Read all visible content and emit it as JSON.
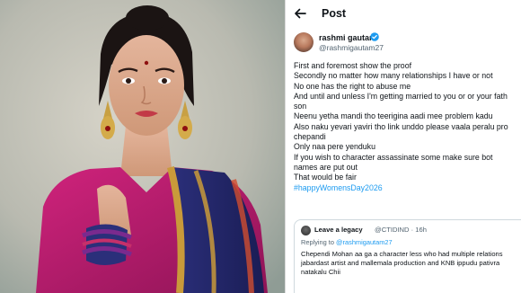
{
  "post_header": {
    "title": "Post"
  },
  "author": {
    "display_name": "rashmi gautam",
    "handle": "@rashmigautam27"
  },
  "post_body": {
    "lines": [
      "First and foremost show the proof",
      "Secondly no matter how many relationships I have or not",
      "No one has the right to abuse me",
      "And until and unless I'm getting married to you or or your fath",
      "son",
      "Neenu yetha mandi tho teerigina aadi mee problem kadu",
      "Also naku yevari yaviri tho link unddo please vaala peralu pro",
      "chepandi",
      "Only naa pere yenduku",
      "If you wish to character assassinate some make sure bot",
      "names are put out",
      "That would be fair"
    ],
    "hashtag": "#happyWomensDay2026"
  },
  "quoted_post": {
    "display_name": "Leave a legacy",
    "handle_time": "@CTIDIND · 16h",
    "replying_prefix": "Replying to",
    "replying_mention": "@rashmigautam27",
    "lines": [
      "Chependi Mohan aa ga  a character less who had multiple relations",
      "jabardast artist and mallemala production and KNB ippudu pativra",
      "natakalu Chii"
    ]
  },
  "icons": {
    "back": "back-arrow-icon",
    "verified": "verified-badge-icon"
  },
  "colors": {
    "accent": "#1d9bf0",
    "text": "#0f1419",
    "secondary_text": "#536471"
  }
}
